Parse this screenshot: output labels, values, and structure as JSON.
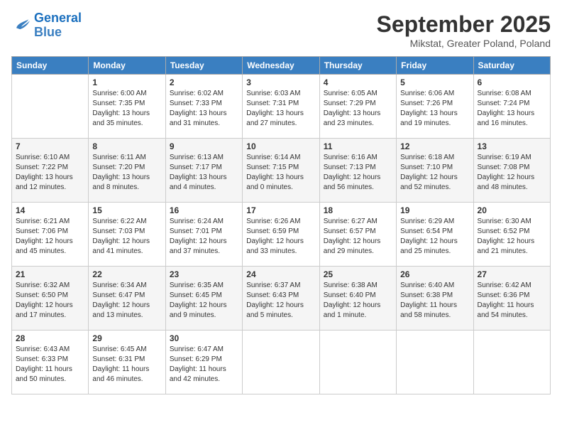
{
  "logo": {
    "line1": "General",
    "line2": "Blue"
  },
  "title": "September 2025",
  "location": "Mikstat, Greater Poland, Poland",
  "days_header": [
    "Sunday",
    "Monday",
    "Tuesday",
    "Wednesday",
    "Thursday",
    "Friday",
    "Saturday"
  ],
  "weeks": [
    [
      {
        "num": "",
        "sunrise": "",
        "sunset": "",
        "daylight": ""
      },
      {
        "num": "1",
        "sunrise": "Sunrise: 6:00 AM",
        "sunset": "Sunset: 7:35 PM",
        "daylight": "Daylight: 13 hours and 35 minutes."
      },
      {
        "num": "2",
        "sunrise": "Sunrise: 6:02 AM",
        "sunset": "Sunset: 7:33 PM",
        "daylight": "Daylight: 13 hours and 31 minutes."
      },
      {
        "num": "3",
        "sunrise": "Sunrise: 6:03 AM",
        "sunset": "Sunset: 7:31 PM",
        "daylight": "Daylight: 13 hours and 27 minutes."
      },
      {
        "num": "4",
        "sunrise": "Sunrise: 6:05 AM",
        "sunset": "Sunset: 7:29 PM",
        "daylight": "Daylight: 13 hours and 23 minutes."
      },
      {
        "num": "5",
        "sunrise": "Sunrise: 6:06 AM",
        "sunset": "Sunset: 7:26 PM",
        "daylight": "Daylight: 13 hours and 19 minutes."
      },
      {
        "num": "6",
        "sunrise": "Sunrise: 6:08 AM",
        "sunset": "Sunset: 7:24 PM",
        "daylight": "Daylight: 13 hours and 16 minutes."
      }
    ],
    [
      {
        "num": "7",
        "sunrise": "Sunrise: 6:10 AM",
        "sunset": "Sunset: 7:22 PM",
        "daylight": "Daylight: 13 hours and 12 minutes."
      },
      {
        "num": "8",
        "sunrise": "Sunrise: 6:11 AM",
        "sunset": "Sunset: 7:20 PM",
        "daylight": "Daylight: 13 hours and 8 minutes."
      },
      {
        "num": "9",
        "sunrise": "Sunrise: 6:13 AM",
        "sunset": "Sunset: 7:17 PM",
        "daylight": "Daylight: 13 hours and 4 minutes."
      },
      {
        "num": "10",
        "sunrise": "Sunrise: 6:14 AM",
        "sunset": "Sunset: 7:15 PM",
        "daylight": "Daylight: 13 hours and 0 minutes."
      },
      {
        "num": "11",
        "sunrise": "Sunrise: 6:16 AM",
        "sunset": "Sunset: 7:13 PM",
        "daylight": "Daylight: 12 hours and 56 minutes."
      },
      {
        "num": "12",
        "sunrise": "Sunrise: 6:18 AM",
        "sunset": "Sunset: 7:10 PM",
        "daylight": "Daylight: 12 hours and 52 minutes."
      },
      {
        "num": "13",
        "sunrise": "Sunrise: 6:19 AM",
        "sunset": "Sunset: 7:08 PM",
        "daylight": "Daylight: 12 hours and 48 minutes."
      }
    ],
    [
      {
        "num": "14",
        "sunrise": "Sunrise: 6:21 AM",
        "sunset": "Sunset: 7:06 PM",
        "daylight": "Daylight: 12 hours and 45 minutes."
      },
      {
        "num": "15",
        "sunrise": "Sunrise: 6:22 AM",
        "sunset": "Sunset: 7:03 PM",
        "daylight": "Daylight: 12 hours and 41 minutes."
      },
      {
        "num": "16",
        "sunrise": "Sunrise: 6:24 AM",
        "sunset": "Sunset: 7:01 PM",
        "daylight": "Daylight: 12 hours and 37 minutes."
      },
      {
        "num": "17",
        "sunrise": "Sunrise: 6:26 AM",
        "sunset": "Sunset: 6:59 PM",
        "daylight": "Daylight: 12 hours and 33 minutes."
      },
      {
        "num": "18",
        "sunrise": "Sunrise: 6:27 AM",
        "sunset": "Sunset: 6:57 PM",
        "daylight": "Daylight: 12 hours and 29 minutes."
      },
      {
        "num": "19",
        "sunrise": "Sunrise: 6:29 AM",
        "sunset": "Sunset: 6:54 PM",
        "daylight": "Daylight: 12 hours and 25 minutes."
      },
      {
        "num": "20",
        "sunrise": "Sunrise: 6:30 AM",
        "sunset": "Sunset: 6:52 PM",
        "daylight": "Daylight: 12 hours and 21 minutes."
      }
    ],
    [
      {
        "num": "21",
        "sunrise": "Sunrise: 6:32 AM",
        "sunset": "Sunset: 6:50 PM",
        "daylight": "Daylight: 12 hours and 17 minutes."
      },
      {
        "num": "22",
        "sunrise": "Sunrise: 6:34 AM",
        "sunset": "Sunset: 6:47 PM",
        "daylight": "Daylight: 12 hours and 13 minutes."
      },
      {
        "num": "23",
        "sunrise": "Sunrise: 6:35 AM",
        "sunset": "Sunset: 6:45 PM",
        "daylight": "Daylight: 12 hours and 9 minutes."
      },
      {
        "num": "24",
        "sunrise": "Sunrise: 6:37 AM",
        "sunset": "Sunset: 6:43 PM",
        "daylight": "Daylight: 12 hours and 5 minutes."
      },
      {
        "num": "25",
        "sunrise": "Sunrise: 6:38 AM",
        "sunset": "Sunset: 6:40 PM",
        "daylight": "Daylight: 12 hours and 1 minute."
      },
      {
        "num": "26",
        "sunrise": "Sunrise: 6:40 AM",
        "sunset": "Sunset: 6:38 PM",
        "daylight": "Daylight: 11 hours and 58 minutes."
      },
      {
        "num": "27",
        "sunrise": "Sunrise: 6:42 AM",
        "sunset": "Sunset: 6:36 PM",
        "daylight": "Daylight: 11 hours and 54 minutes."
      }
    ],
    [
      {
        "num": "28",
        "sunrise": "Sunrise: 6:43 AM",
        "sunset": "Sunset: 6:33 PM",
        "daylight": "Daylight: 11 hours and 50 minutes."
      },
      {
        "num": "29",
        "sunrise": "Sunrise: 6:45 AM",
        "sunset": "Sunset: 6:31 PM",
        "daylight": "Daylight: 11 hours and 46 minutes."
      },
      {
        "num": "30",
        "sunrise": "Sunrise: 6:47 AM",
        "sunset": "Sunset: 6:29 PM",
        "daylight": "Daylight: 11 hours and 42 minutes."
      },
      {
        "num": "",
        "sunrise": "",
        "sunset": "",
        "daylight": ""
      },
      {
        "num": "",
        "sunrise": "",
        "sunset": "",
        "daylight": ""
      },
      {
        "num": "",
        "sunrise": "",
        "sunset": "",
        "daylight": ""
      },
      {
        "num": "",
        "sunrise": "",
        "sunset": "",
        "daylight": ""
      }
    ]
  ]
}
